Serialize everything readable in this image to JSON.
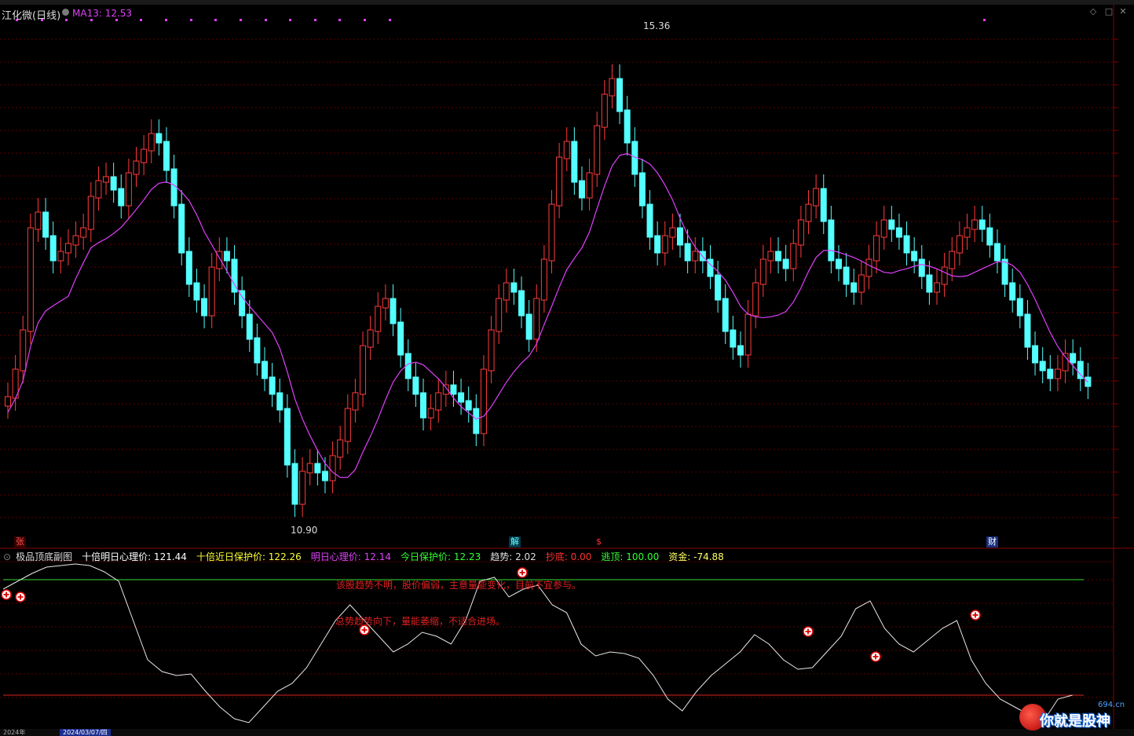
{
  "stock": {
    "title": "江化微(日线)",
    "ma_label": "MA13: 12.53",
    "high_label": "15.36",
    "low_label": "10.90"
  },
  "markers": {
    "zhang": "张",
    "jie": "解",
    "dollar": "$",
    "cai": "财"
  },
  "indicator": {
    "name": "极品顶底副图",
    "items": [
      {
        "label": "十倍明日心理价: 121.44",
        "color": "#ffffff"
      },
      {
        "label": "十倍近日保护价: 122.26",
        "color": "#ffff33"
      },
      {
        "label": "明日心理价: 12.14",
        "color": "#e040fb"
      },
      {
        "label": "今日保护价: 12.23",
        "color": "#33ff33"
      },
      {
        "label": "趋势: 2.02",
        "color": "#dddddd"
      },
      {
        "label": "抄底: 0.00",
        "color": "#ff3333"
      },
      {
        "label": "逃顶: 100.00",
        "color": "#33ff33"
      },
      {
        "label": "资金: -74.88",
        "color": "#ffff66"
      }
    ],
    "note1": "该股趋势不明，股价偏弱，主意量能变化，目前不宜参与。",
    "note2": "总势趋势向下，量能萎缩，不适合进场。"
  },
  "date_bar": {
    "year": "2024年",
    "selected": "2024/03/07/四"
  },
  "logo": {
    "text": "你就是股神",
    "site": "694.cn"
  },
  "colors": {
    "up": "#ff3b3b",
    "down": "#54ffff",
    "ma": "#e040fb",
    "grid": "#5a0000"
  }
}
